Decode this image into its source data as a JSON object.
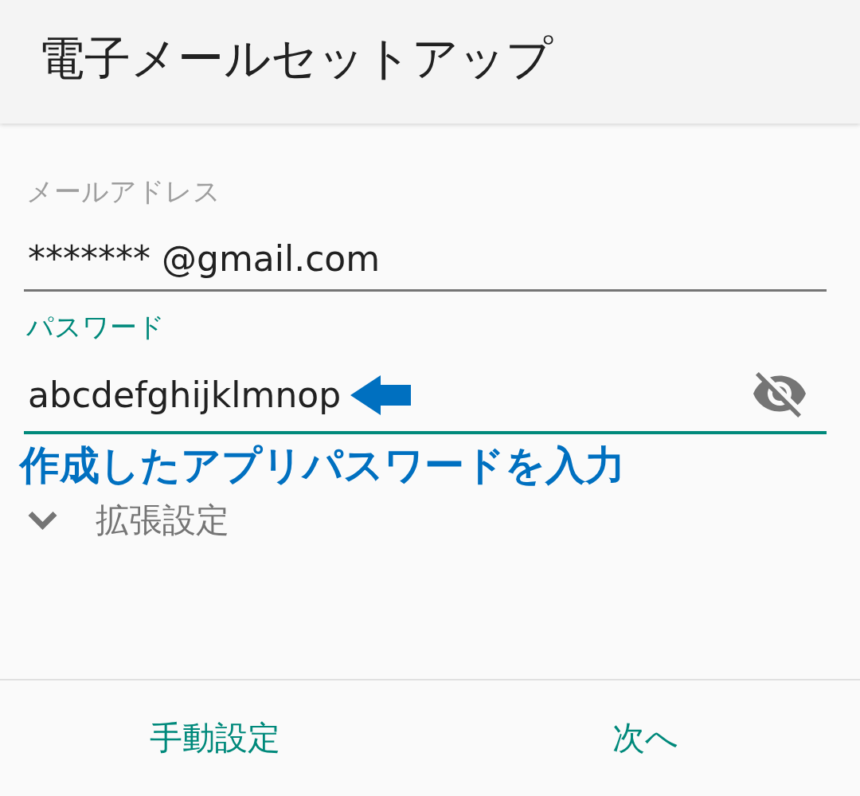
{
  "app_bar": {
    "title": "電子メールセットアップ"
  },
  "fields": [
    {
      "kind": "text",
      "label": "メールアドレス",
      "value": "******* @gmail.com",
      "focused": false
    },
    {
      "kind": "password",
      "label": "パスワード",
      "value": "abcdefghijklmnop",
      "focused": true
    }
  ],
  "annotation": {
    "text": "作成したアプリパスワードを入力"
  },
  "advanced": {
    "label": "拡張設定",
    "expanded": false
  },
  "buttons": [
    {
      "label": "手動設定"
    },
    {
      "label": "次へ"
    }
  ]
}
